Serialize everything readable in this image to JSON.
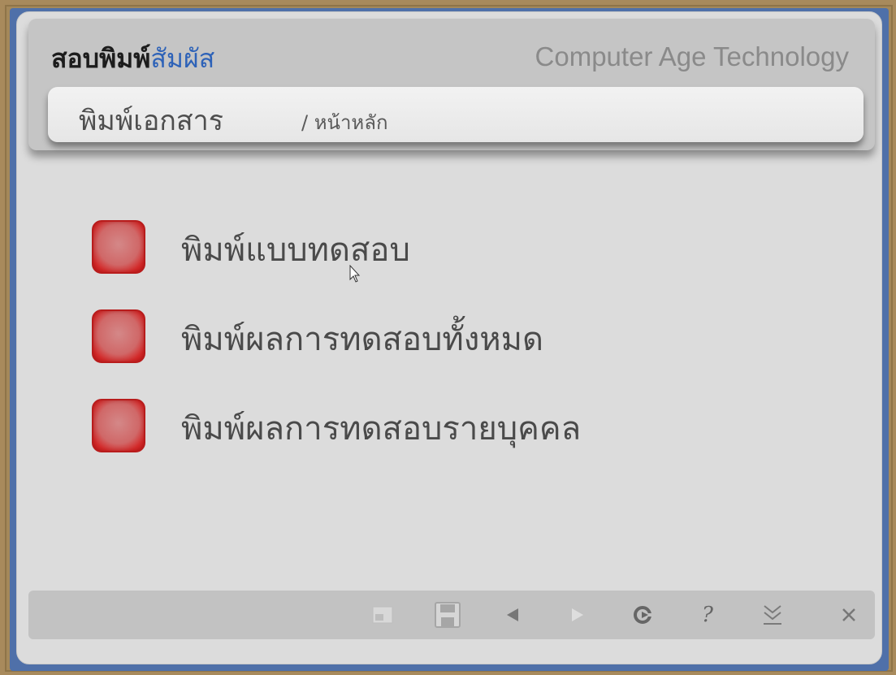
{
  "header": {
    "brand_part1": "สอบพิมพ์",
    "brand_part2": "สัมผัส",
    "tagline": "Computer Age Technology"
  },
  "breadcrumb": {
    "title": "พิมพ์เอกสาร",
    "sub": "/ หน้าหลัก"
  },
  "menu": {
    "items": [
      {
        "label": "พิมพ์แบบทดสอบ"
      },
      {
        "label": "พิมพ์ผลการทดสอบทั้งหมด"
      },
      {
        "label": "พิมพ์ผลการทดสอบรายบุคคล"
      }
    ]
  },
  "toolbar": {
    "icons": [
      "window-icon",
      "save-icon",
      "back-icon",
      "forward-icon",
      "refresh-icon",
      "help-icon",
      "collapse-icon",
      "close-icon"
    ]
  },
  "colors": {
    "brand_blue": "#2d62b8",
    "menu_box": "#d42a2a",
    "window_border": "#4f70a9"
  }
}
